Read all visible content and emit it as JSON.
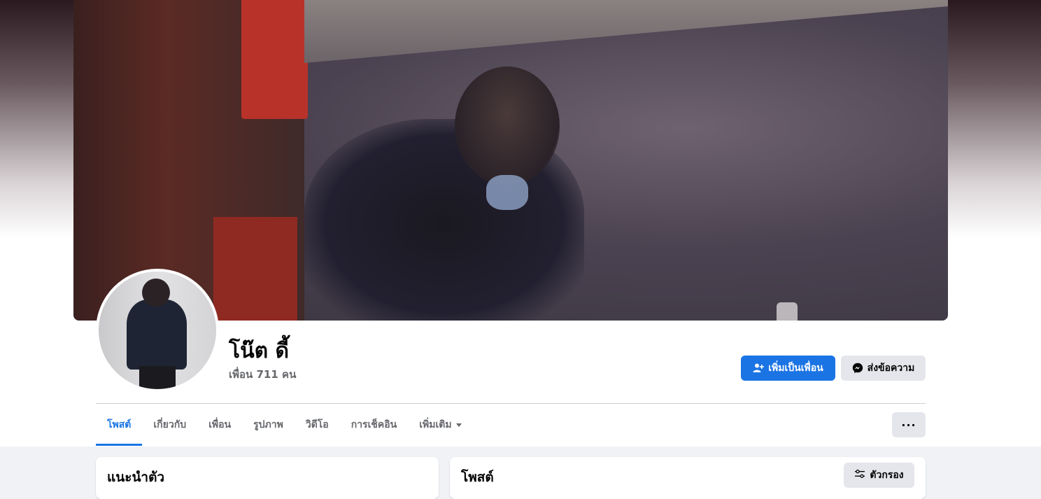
{
  "profile": {
    "name": "โน๊ต ดี้",
    "friends_count": "เพื่อน 711 คน"
  },
  "actions": {
    "add_friend_label": "เพิ่มเป็นเพื่อน",
    "message_label": "ส่งข้อความ",
    "more_label": "···"
  },
  "tabs": [
    {
      "label": "โพสต์",
      "active": true
    },
    {
      "label": "เกี่ยวกับ"
    },
    {
      "label": "เพื่อน"
    },
    {
      "label": "รูปภาพ"
    },
    {
      "label": "วิดีโอ"
    },
    {
      "label": "การเช็คอิน"
    },
    {
      "label": "เพิ่มเติม"
    }
  ],
  "intro": {
    "title": "แนะนำตัว"
  },
  "posts": {
    "title": "โพสต์",
    "filter_label": "ตัวกรอง"
  },
  "colors": {
    "accent": "#1b74e4",
    "secondary_button": "#e4e6eb",
    "muted_text": "#65676b",
    "page_bg": "#f0f2f5"
  },
  "icons": {
    "add_friend": "person-add-icon",
    "message": "messenger-icon",
    "filter": "sliders-icon",
    "dropdown": "caret-down-icon"
  }
}
